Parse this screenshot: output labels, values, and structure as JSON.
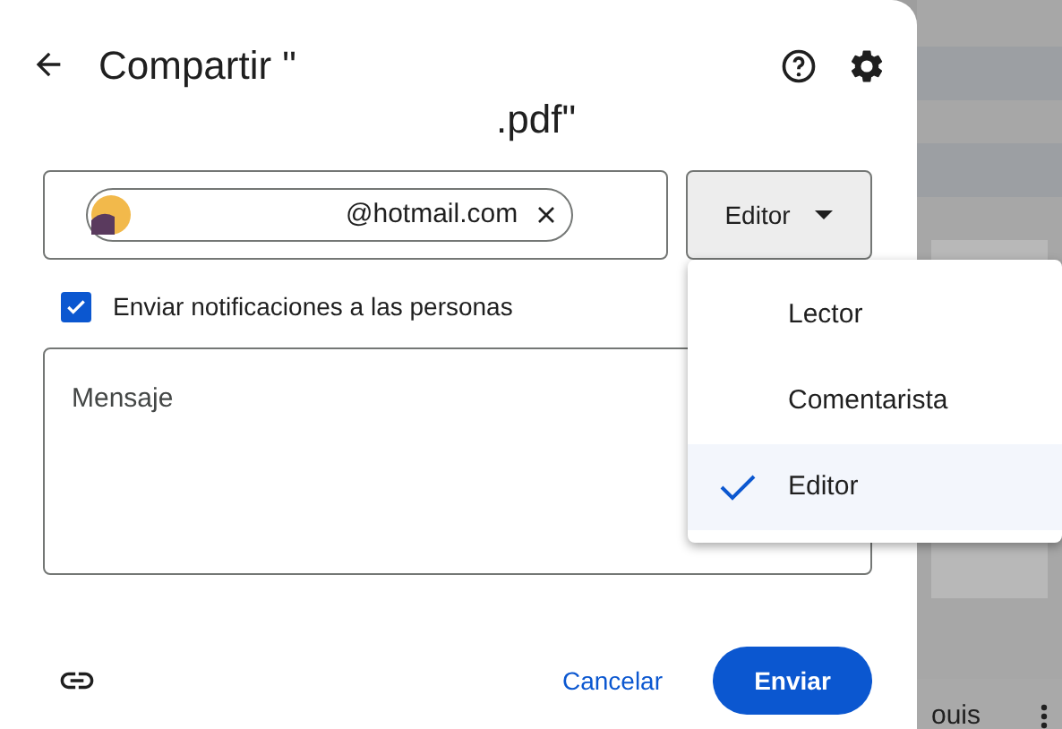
{
  "dialog": {
    "title_line_1": "Compartir \"",
    "title_line_2": ".pdf\"",
    "recipient": {
      "email": "@hotmail.com"
    },
    "role_button": {
      "label": "Editor"
    },
    "notify": {
      "label": "Enviar notificaciones a las personas",
      "checked": true
    },
    "message": {
      "placeholder": "Mensaje"
    },
    "buttons": {
      "cancel": "Cancelar",
      "send": "Enviar"
    }
  },
  "role_menu": [
    {
      "label": "Lector",
      "selected": false
    },
    {
      "label": "Comentarista",
      "selected": false
    },
    {
      "label": "Editor",
      "selected": true
    }
  ],
  "background": {
    "file_name": "ouis"
  }
}
